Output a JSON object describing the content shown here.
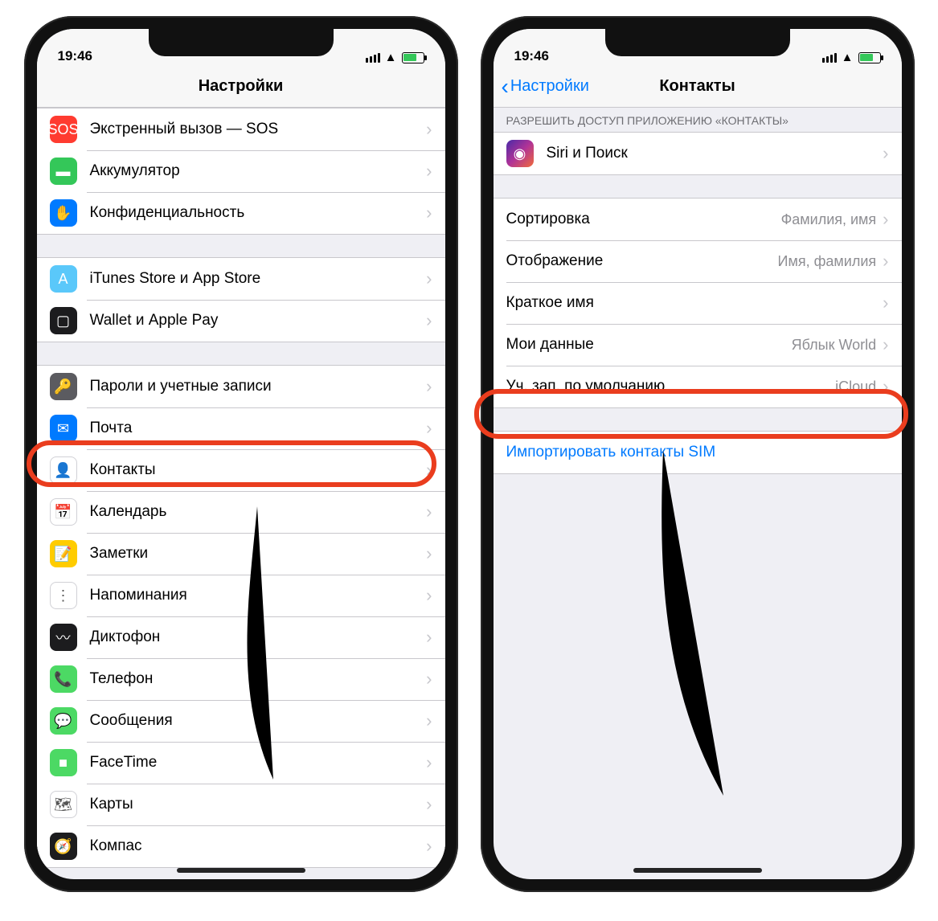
{
  "status": {
    "time": "19:46"
  },
  "leftPhone": {
    "title": "Настройки",
    "groups": [
      {
        "rows": [
          {
            "label": "Экстренный вызов — SOS",
            "iconText": "SOS",
            "iconClass": "bg-red",
            "name": "row-sos"
          },
          {
            "label": "Аккумулятор",
            "iconText": "▬",
            "iconClass": "bg-green",
            "name": "row-battery"
          },
          {
            "label": "Конфиденциальность",
            "iconText": "✋",
            "iconClass": "bg-blue",
            "name": "row-privacy"
          }
        ]
      },
      {
        "rows": [
          {
            "label": "iTunes Store и App Store",
            "iconText": "A",
            "iconClass": "bg-teal",
            "name": "row-appstore"
          },
          {
            "label": "Wallet и Apple Pay",
            "iconText": "▢",
            "iconClass": "bg-dblack",
            "name": "row-wallet"
          }
        ]
      },
      {
        "rows": [
          {
            "label": "Пароли и учетные записи",
            "iconText": "🔑",
            "iconClass": "bg-darkgray",
            "name": "row-passwords"
          },
          {
            "label": "Почта",
            "iconText": "✉",
            "iconClass": "bg-blue",
            "name": "row-mail"
          },
          {
            "label": "Контакты",
            "iconText": "👤",
            "iconClass": "bg-white",
            "name": "row-contacts",
            "highlight": true
          },
          {
            "label": "Календарь",
            "iconText": "📅",
            "iconClass": "bg-white",
            "name": "row-calendar"
          },
          {
            "label": "Заметки",
            "iconText": "📝",
            "iconClass": "bg-yellow",
            "name": "row-notes"
          },
          {
            "label": "Напоминания",
            "iconText": "⋮",
            "iconClass": "bg-white",
            "name": "row-reminders"
          },
          {
            "label": "Диктофон",
            "iconText": "〰",
            "iconClass": "bg-dblack",
            "name": "row-voicememos"
          },
          {
            "label": "Телефон",
            "iconText": "📞",
            "iconClass": "bg-lgreen",
            "name": "row-phone"
          },
          {
            "label": "Сообщения",
            "iconText": "💬",
            "iconClass": "bg-lgreen",
            "name": "row-messages"
          },
          {
            "label": "FaceTime",
            "iconText": "■",
            "iconClass": "bg-lgreen",
            "name": "row-facetime"
          },
          {
            "label": "Карты",
            "iconText": "🗺",
            "iconClass": "bg-white",
            "name": "row-maps"
          },
          {
            "label": "Компас",
            "iconText": "🧭",
            "iconClass": "bg-dblack",
            "name": "row-compass"
          }
        ]
      }
    ]
  },
  "rightPhone": {
    "backLabel": "Настройки",
    "title": "Контакты",
    "sectionHeader": "РАЗРЕШИТЬ ДОСТУП ПРИЛОЖЕНИЮ «КОНТАКТЫ»",
    "siriRow": {
      "label": "Siri и Поиск",
      "iconClass": "bg-siri",
      "iconText": "◉"
    },
    "optionRows": [
      {
        "label": "Сортировка",
        "detail": "Фамилия, имя",
        "name": "row-sort"
      },
      {
        "label": "Отображение",
        "detail": "Имя, фамилия",
        "name": "row-display"
      },
      {
        "label": "Краткое имя",
        "detail": "",
        "name": "row-shortname"
      },
      {
        "label": "Мои данные",
        "detail": "Яблык World",
        "name": "row-myinfo"
      },
      {
        "label": "Уч. зап. по умолчанию",
        "detail": "iCloud",
        "name": "row-default-account",
        "highlight": true
      }
    ],
    "importLabel": "Импортировать контакты SIM"
  }
}
